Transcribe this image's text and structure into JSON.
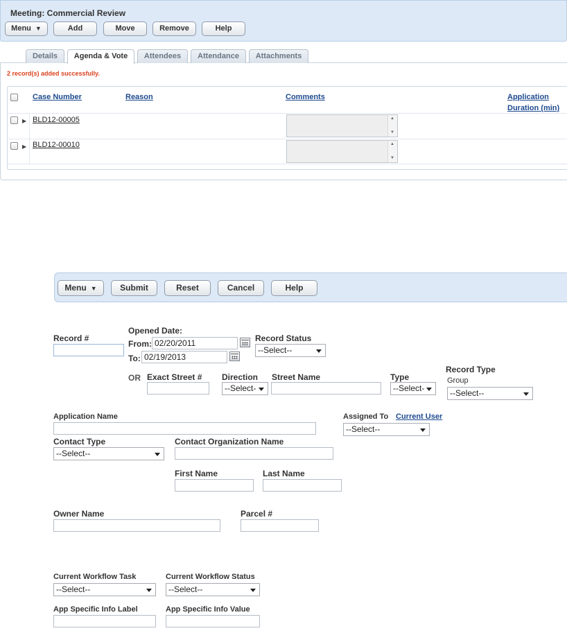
{
  "meeting": {
    "title": "Meeting: Commercial Review",
    "toolbar": {
      "menu": "Menu",
      "add": "Add",
      "move": "Move",
      "remove": "Remove",
      "help": "Help"
    },
    "tabs": [
      "Details",
      "Agenda & Vote",
      "Attendees",
      "Attendance",
      "Attachments"
    ],
    "active_tab": "Agenda & Vote",
    "message": "2 record(s) added successfully.",
    "grid": {
      "headers": {
        "case_number": "Case Number",
        "reason": "Reason",
        "comments": "Comments",
        "application": "Application",
        "duration": "Duration (min)"
      },
      "rows": [
        {
          "case_number": "BLD12-00005"
        },
        {
          "case_number": "BLD12-00010"
        }
      ]
    }
  },
  "search": {
    "toolbar": {
      "menu": "Menu",
      "submit": "Submit",
      "reset": "Reset",
      "cancel": "Cancel",
      "help": "Help"
    },
    "record_num_label": "Record #",
    "opened_date_label": "Opened Date:",
    "from_label": "From:",
    "from_value": "02/20/2011",
    "to_label": "To:",
    "to_value": "02/19/2013",
    "record_status_label": "Record Status",
    "record_status_value": "--Select--",
    "or_label": "OR",
    "exact_street_label": "Exact Street #",
    "direction_label": "Direction",
    "direction_value": "--Select-",
    "street_name_label": "Street Name",
    "type_label": "Type",
    "type_value": "--Select-",
    "record_type_label": "Record Type",
    "group_label": "Group",
    "group_value": "--Select--",
    "application_name_label": "Application Name",
    "assigned_to_label": "Assigned To",
    "current_user_link": "Current User",
    "assigned_to_value": "--Select--",
    "contact_type_label": "Contact Type",
    "contact_type_value": "--Select--",
    "contact_org_label": "Contact Organization Name",
    "first_name_label": "First Name",
    "last_name_label": "Last Name",
    "owner_name_label": "Owner Name",
    "parcel_label": "Parcel #",
    "workflow_task_label": "Current Workflow Task",
    "workflow_task_value": "--Select--",
    "workflow_status_label": "Current Workflow Status",
    "workflow_status_value": "--Select--",
    "asi_label_label": "App Specific Info Label",
    "asi_value_label": "App Specific Info Value"
  }
}
